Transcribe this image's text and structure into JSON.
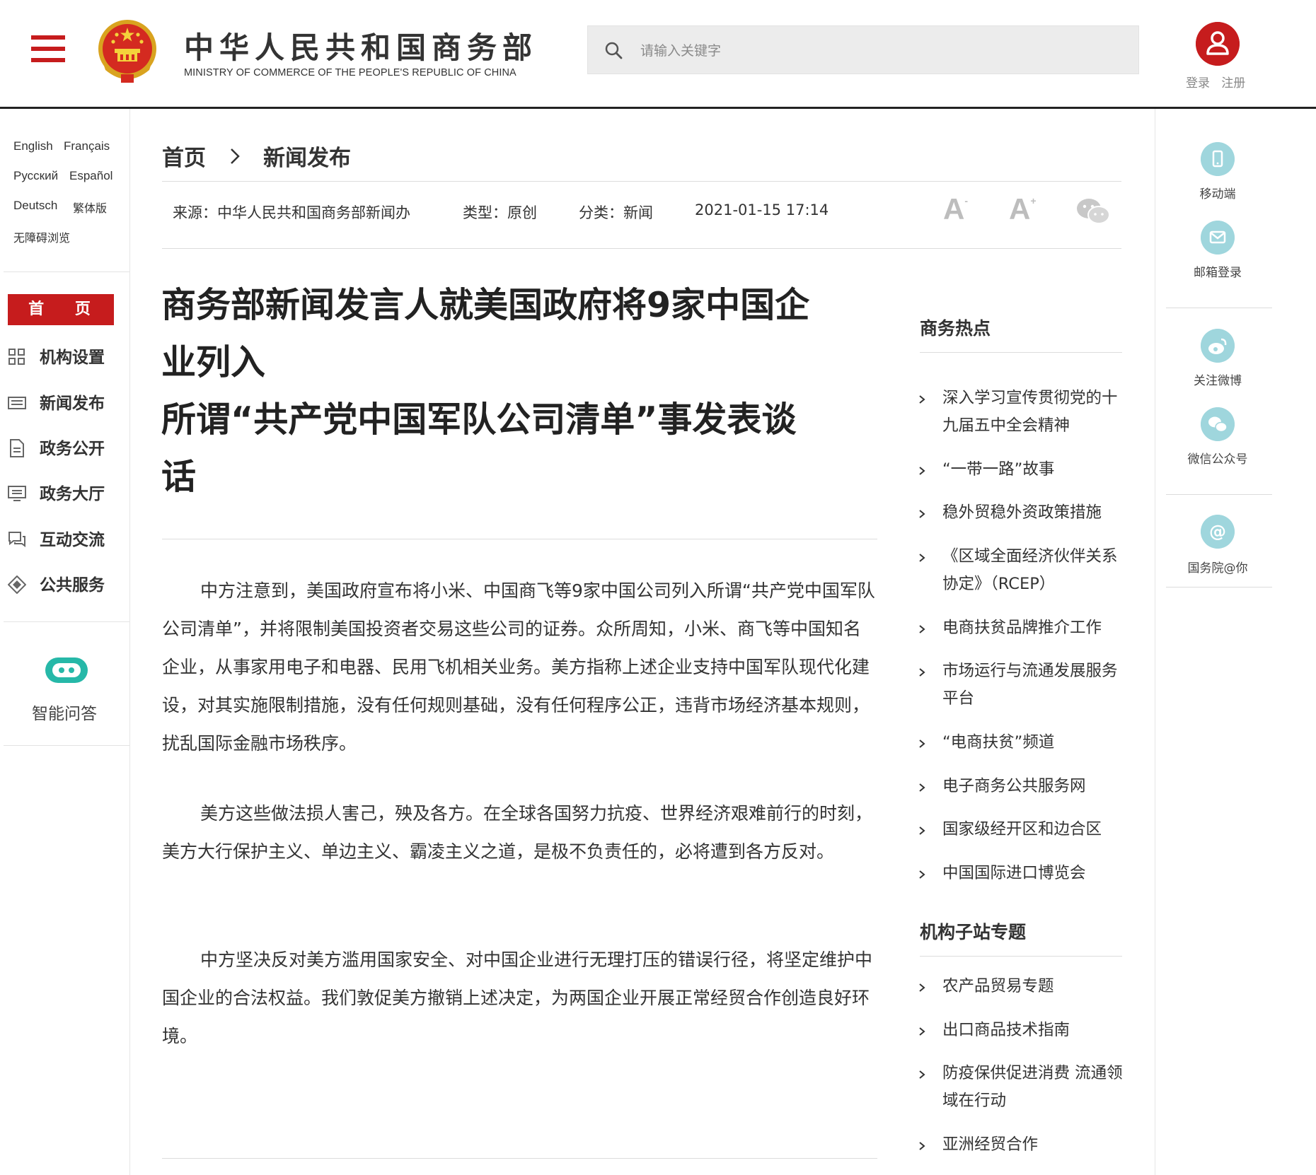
{
  "header": {
    "title": "中华人民共和国商务部",
    "subtitle": "MINISTRY OF COMMERCE OF THE PEOPLE'S REPUBLIC OF CHINA",
    "search_placeholder": "请输入关键字",
    "login": "登录",
    "register": "注册"
  },
  "languages": [
    "English",
    "Français",
    "Русский",
    "Español",
    "Deutsch",
    "繁体版",
    "无障碍浏览"
  ],
  "left_nav": {
    "home": "首 页",
    "items": [
      "机构设置",
      "新闻发布",
      "政务公开",
      "政务大厅",
      "互动交流",
      "公共服务"
    ],
    "ai": "智能问答"
  },
  "breadcrumb": {
    "home": "首页",
    "current": "新闻发布"
  },
  "meta": {
    "source": "来源：中华人民共和国商务部新闻办",
    "type": "类型：原创",
    "category": "分类：新闻",
    "datetime": "2021-01-15 17:14"
  },
  "font_controls": {
    "decrease": "A",
    "decrease_sup": "-",
    "increase": "A",
    "increase_sup": "+"
  },
  "article": {
    "title_lines": [
      "商务部新闻发言人就美国政府将9家中国企",
      "业列入",
      "所谓“共产党中国军队公司清单”事发表谈",
      "话"
    ],
    "paragraphs": [
      "中方注意到，美国政府宣布将小米、中国商飞等9家中国公司列入所谓“共产党中国军队公司清单”，并将限制美国投资者交易这些公司的证券。众所周知，小米、商飞等中国知名企业，从事家用电子和电器、民用飞机相关业务。美方指称上述企业支持中国军队现代化建设，对其实施限制措施，没有任何规则基础，没有任何程序公正，违背市场经济基本规则，扰乱国际金融市场秩序。",
      "美方这些做法损人害己，殃及各方。在全球各国努力抗疫、世界经济艰难前行的时刻，美方大行保护主义、单边主义、霸凌主义之道，是极不负责任的，必将遭到各方反对。",
      "中方坚决反对美方滥用国家安全、对中国企业进行无理打压的错误行径，将坚定维护中国企业的合法权益。我们敦促美方撤销上述决定，为两国企业开展正常经贸合作创造良好环境。"
    ]
  },
  "hot": {
    "title": "商务热点",
    "items": [
      "深入学习宣传贯彻党的十九届五中全会精神",
      "“一带一路”故事",
      "稳外贸稳外资政策措施",
      "《区域全面经济伙伴关系协定》（RCEP）",
      "电商扶贫品牌推介工作",
      "市场运行与流通发展服务平台",
      "“电商扶贫”频道",
      "电子商务公共服务网",
      "国家级经开区和边合区",
      "中国国际进口博览会"
    ]
  },
  "sub_sites": {
    "title": "机构子站专题",
    "items": [
      "农产品贸易专题",
      "出口商品技术指南",
      "防疫保供促进消费 流通领域在行动",
      "亚洲经贸合作"
    ]
  },
  "right_sidebar": {
    "items": [
      "移动端",
      "邮箱登录",
      "关注微博",
      "微信公众号",
      "国务院@你"
    ]
  },
  "colors": {
    "brand_red": "#c61c1d",
    "icon_teal": "#9fd6dd"
  }
}
